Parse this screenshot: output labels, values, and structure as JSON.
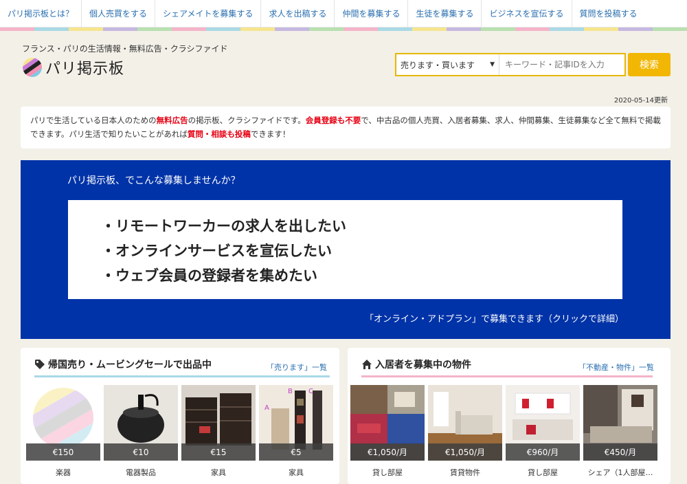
{
  "nav": {
    "items": [
      {
        "label": "パリ掲示板とは？"
      },
      {
        "label": "個人売買をする"
      },
      {
        "label": "シェアメイトを募集する"
      },
      {
        "label": "求人を出稿する"
      },
      {
        "label": "仲間を募集する"
      },
      {
        "label": "生徒を募集する"
      },
      {
        "label": "ビジネスを宣伝する"
      },
      {
        "label": "質問を投稿する"
      }
    ]
  },
  "stripe_colors": [
    "#f4b4c8",
    "#a9d9e6",
    "#f6e58d",
    "#c5b8e0",
    "#b8e0b0",
    "#f4b4c8",
    "#a9d9e6",
    "#f6e58d",
    "#c5b8e0",
    "#b8e0b0",
    "#f4b4c8",
    "#a9d9e6",
    "#f6e58d",
    "#c5b8e0",
    "#b8e0b0",
    "#f4b4c8",
    "#a9d9e6",
    "#f6e58d",
    "#c5b8e0",
    "#b8e0b0"
  ],
  "header": {
    "tagline": "フランス・パリの生活情報・無料広告・クラシファイド",
    "logo_text": "パリ掲示板"
  },
  "search": {
    "category": "売ります・買います",
    "placeholder": "キーワード・記事IDを入力",
    "button": "検索"
  },
  "updated": "2020-05-14更新",
  "intro": {
    "t1": "パリで生活している日本人のための",
    "r1": "無料広告",
    "t2": "の掲示板、クラシファイドです。",
    "r2": "会員登録も不要",
    "t3": "で、中古品の個人売買、入居者募集、求人、仲間募集、生徒募集など全て無料で掲載できます。パリ生活で知りたいことがあれば",
    "r3": "質問・相談も投稿",
    "t4": "できます！"
  },
  "banner": {
    "title": "パリ掲示板、でこんな募集しませんか？",
    "lines": [
      "・リモートワーカーの求人を出したい",
      "・オンラインサービスを宣伝したい",
      "・ウェブ会員の登録者を集めたい"
    ],
    "cta": "「オンライン・アドプラン」で募集できます（クリックで詳細）"
  },
  "sell": {
    "title": "帰国売り・ムービングセールで出品中",
    "link": "「売ります」一覧",
    "items": [
      {
        "price": "€150",
        "category": "楽器"
      },
      {
        "price": "€10",
        "category": "電器製品"
      },
      {
        "price": "€15",
        "category": "家具"
      },
      {
        "price": "€5",
        "category": "家具"
      }
    ]
  },
  "rent": {
    "title": "入居者を募集中の物件",
    "link": "「不動産・物件」一覧",
    "items": [
      {
        "price": "€1,050/月",
        "category": "貸し部屋"
      },
      {
        "price": "€1,050/月",
        "category": "賃貸物件"
      },
      {
        "price": "€960/月",
        "category": "貸し部屋"
      },
      {
        "price": "€450/月",
        "category": "シェア（1人部屋…"
      }
    ]
  },
  "photo_marks": {
    "a": "A",
    "b": "B",
    "c": "C"
  }
}
